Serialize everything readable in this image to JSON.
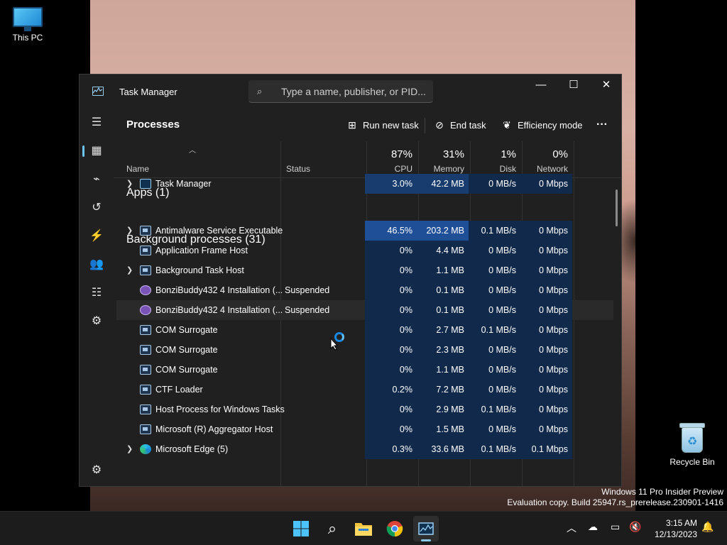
{
  "desktop": {
    "icons": [
      {
        "label": "This PC"
      },
      {
        "label": "Recycle Bin"
      }
    ],
    "watermark": {
      "line1": "Windows 11 Pro Insider Preview",
      "line2": "Evaluation copy. Build 25947.rs_prerelease.230901-1416"
    }
  },
  "window": {
    "title": "Task Manager",
    "search_placeholder": "Type a name, publisher, or PID...",
    "controls": {
      "minimize": "—",
      "maximize": "☐",
      "close": "✕"
    }
  },
  "sidebar": {
    "items": [
      {
        "name": "menu",
        "glyph": "☰"
      },
      {
        "name": "processes",
        "glyph": "▦"
      },
      {
        "name": "performance",
        "glyph": "⌁"
      },
      {
        "name": "app-history",
        "glyph": "↺"
      },
      {
        "name": "startup-apps",
        "glyph": "⚡"
      },
      {
        "name": "users",
        "glyph": "👥"
      },
      {
        "name": "details",
        "glyph": "☷"
      },
      {
        "name": "services",
        "glyph": "⚙"
      }
    ],
    "settings_glyph": "⚙"
  },
  "toolbar": {
    "page_title": "Processes",
    "run_new_task": "Run new task",
    "end_task": "End task",
    "efficiency_mode": "Efficiency mode",
    "more": "···"
  },
  "columns": {
    "name": "Name",
    "status": "Status",
    "cpu": {
      "pct": "87%",
      "label": "CPU"
    },
    "memory": {
      "pct": "31%",
      "label": "Memory"
    },
    "disk": {
      "pct": "1%",
      "label": "Disk"
    },
    "network": {
      "pct": "0%",
      "label": "Network"
    }
  },
  "groups": {
    "apps": "Apps (1)",
    "background": "Background processes (31)"
  },
  "rows": [
    {
      "name": "Task Manager",
      "status": "",
      "cpu": "3.0%",
      "mem": "42.2 MB",
      "disk": "0 MB/s",
      "net": "0 Mbps"
    },
    {
      "name": "Antimalware Service Executable",
      "status": "",
      "cpu": "46.5%",
      "mem": "203.2 MB",
      "disk": "0.1 MB/s",
      "net": "0 Mbps"
    },
    {
      "name": "Application Frame Host",
      "status": "",
      "cpu": "0%",
      "mem": "4.4 MB",
      "disk": "0 MB/s",
      "net": "0 Mbps"
    },
    {
      "name": "Background Task Host",
      "status": "",
      "cpu": "0%",
      "mem": "1.1 MB",
      "disk": "0 MB/s",
      "net": "0 Mbps"
    },
    {
      "name": "BonziBuddy432 4 Installation (...",
      "status": "Suspended",
      "cpu": "0%",
      "mem": "0.1 MB",
      "disk": "0 MB/s",
      "net": "0 Mbps"
    },
    {
      "name": "BonziBuddy432 4 Installation (...",
      "status": "Suspended",
      "cpu": "0%",
      "mem": "0.1 MB",
      "disk": "0 MB/s",
      "net": "0 Mbps"
    },
    {
      "name": "COM Surrogate",
      "status": "",
      "cpu": "0%",
      "mem": "2.7 MB",
      "disk": "0.1 MB/s",
      "net": "0 Mbps"
    },
    {
      "name": "COM Surrogate",
      "status": "",
      "cpu": "0%",
      "mem": "2.3 MB",
      "disk": "0 MB/s",
      "net": "0 Mbps"
    },
    {
      "name": "COM Surrogate",
      "status": "",
      "cpu": "0%",
      "mem": "1.1 MB",
      "disk": "0 MB/s",
      "net": "0 Mbps"
    },
    {
      "name": "CTF Loader",
      "status": "",
      "cpu": "0.2%",
      "mem": "7.2 MB",
      "disk": "0 MB/s",
      "net": "0 Mbps"
    },
    {
      "name": "Host Process for Windows Tasks",
      "status": "",
      "cpu": "0%",
      "mem": "2.9 MB",
      "disk": "0.1 MB/s",
      "net": "0 Mbps"
    },
    {
      "name": "Microsoft (R) Aggregator Host",
      "status": "",
      "cpu": "0%",
      "mem": "1.5 MB",
      "disk": "0 MB/s",
      "net": "0 Mbps"
    },
    {
      "name": "Microsoft Edge (5)",
      "status": "",
      "cpu": "0.3%",
      "mem": "33.6 MB",
      "disk": "0.1 MB/s",
      "net": "0.1 Mbps"
    }
  ],
  "taskbar": {
    "time": "3:15 AM",
    "date": "12/13/2023"
  },
  "colors": {
    "accent": "#6cc4f5",
    "heat_low": "#11294a",
    "heat_mid": "#183c6e",
    "heat_high": "#1f4f96"
  }
}
